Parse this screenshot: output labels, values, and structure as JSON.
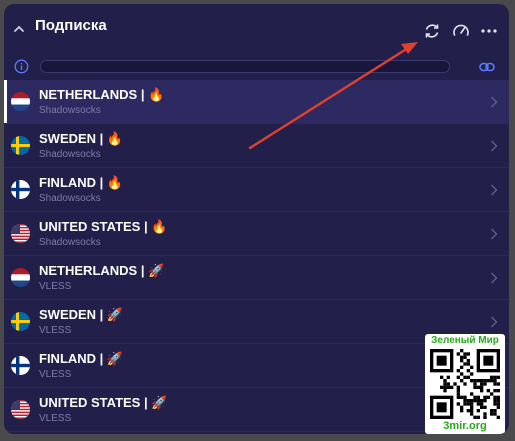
{
  "header": {
    "title": "Подписка",
    "icons": [
      "chevron-up-icon",
      "refresh-icon",
      "speedometer-icon",
      "more-icon"
    ]
  },
  "info_row": {
    "icons": [
      "info-icon",
      "link-icon"
    ]
  },
  "colors": {
    "panel": "#22204a",
    "active_row": "#2c2a60",
    "accent_blue": "#5b7bff",
    "annotation_arrow": "#e0402c",
    "watermark_green": "#29a81b"
  },
  "servers": [
    {
      "name": "NETHERLANDS | ",
      "emoji": "🔥",
      "protocol": "Shadowsocks",
      "flag": "nl",
      "active": true
    },
    {
      "name": "SWEDEN | ",
      "emoji": "🔥",
      "protocol": "Shadowsocks",
      "flag": "se",
      "active": false
    },
    {
      "name": "FINLAND | ",
      "emoji": "🔥",
      "protocol": "Shadowsocks",
      "flag": "fi",
      "active": false
    },
    {
      "name": "UNITED STATES | ",
      "emoji": "🔥",
      "protocol": "Shadowsocks",
      "flag": "us",
      "active": false
    },
    {
      "name": "NETHERLANDS | ",
      "emoji": "🚀",
      "protocol": "VLESS",
      "flag": "nl",
      "active": false
    },
    {
      "name": "SWEDEN | ",
      "emoji": "🚀",
      "protocol": "VLESS",
      "flag": "se",
      "active": false
    },
    {
      "name": "FINLAND | ",
      "emoji": "🚀",
      "protocol": "VLESS",
      "flag": "fi",
      "active": false
    },
    {
      "name": "UNITED STATES | ",
      "emoji": "🚀",
      "protocol": "VLESS",
      "flag": "us",
      "active": false
    }
  ],
  "watermark": {
    "top_text": "Зеленый Мир",
    "bottom_text": "3mir.org"
  }
}
